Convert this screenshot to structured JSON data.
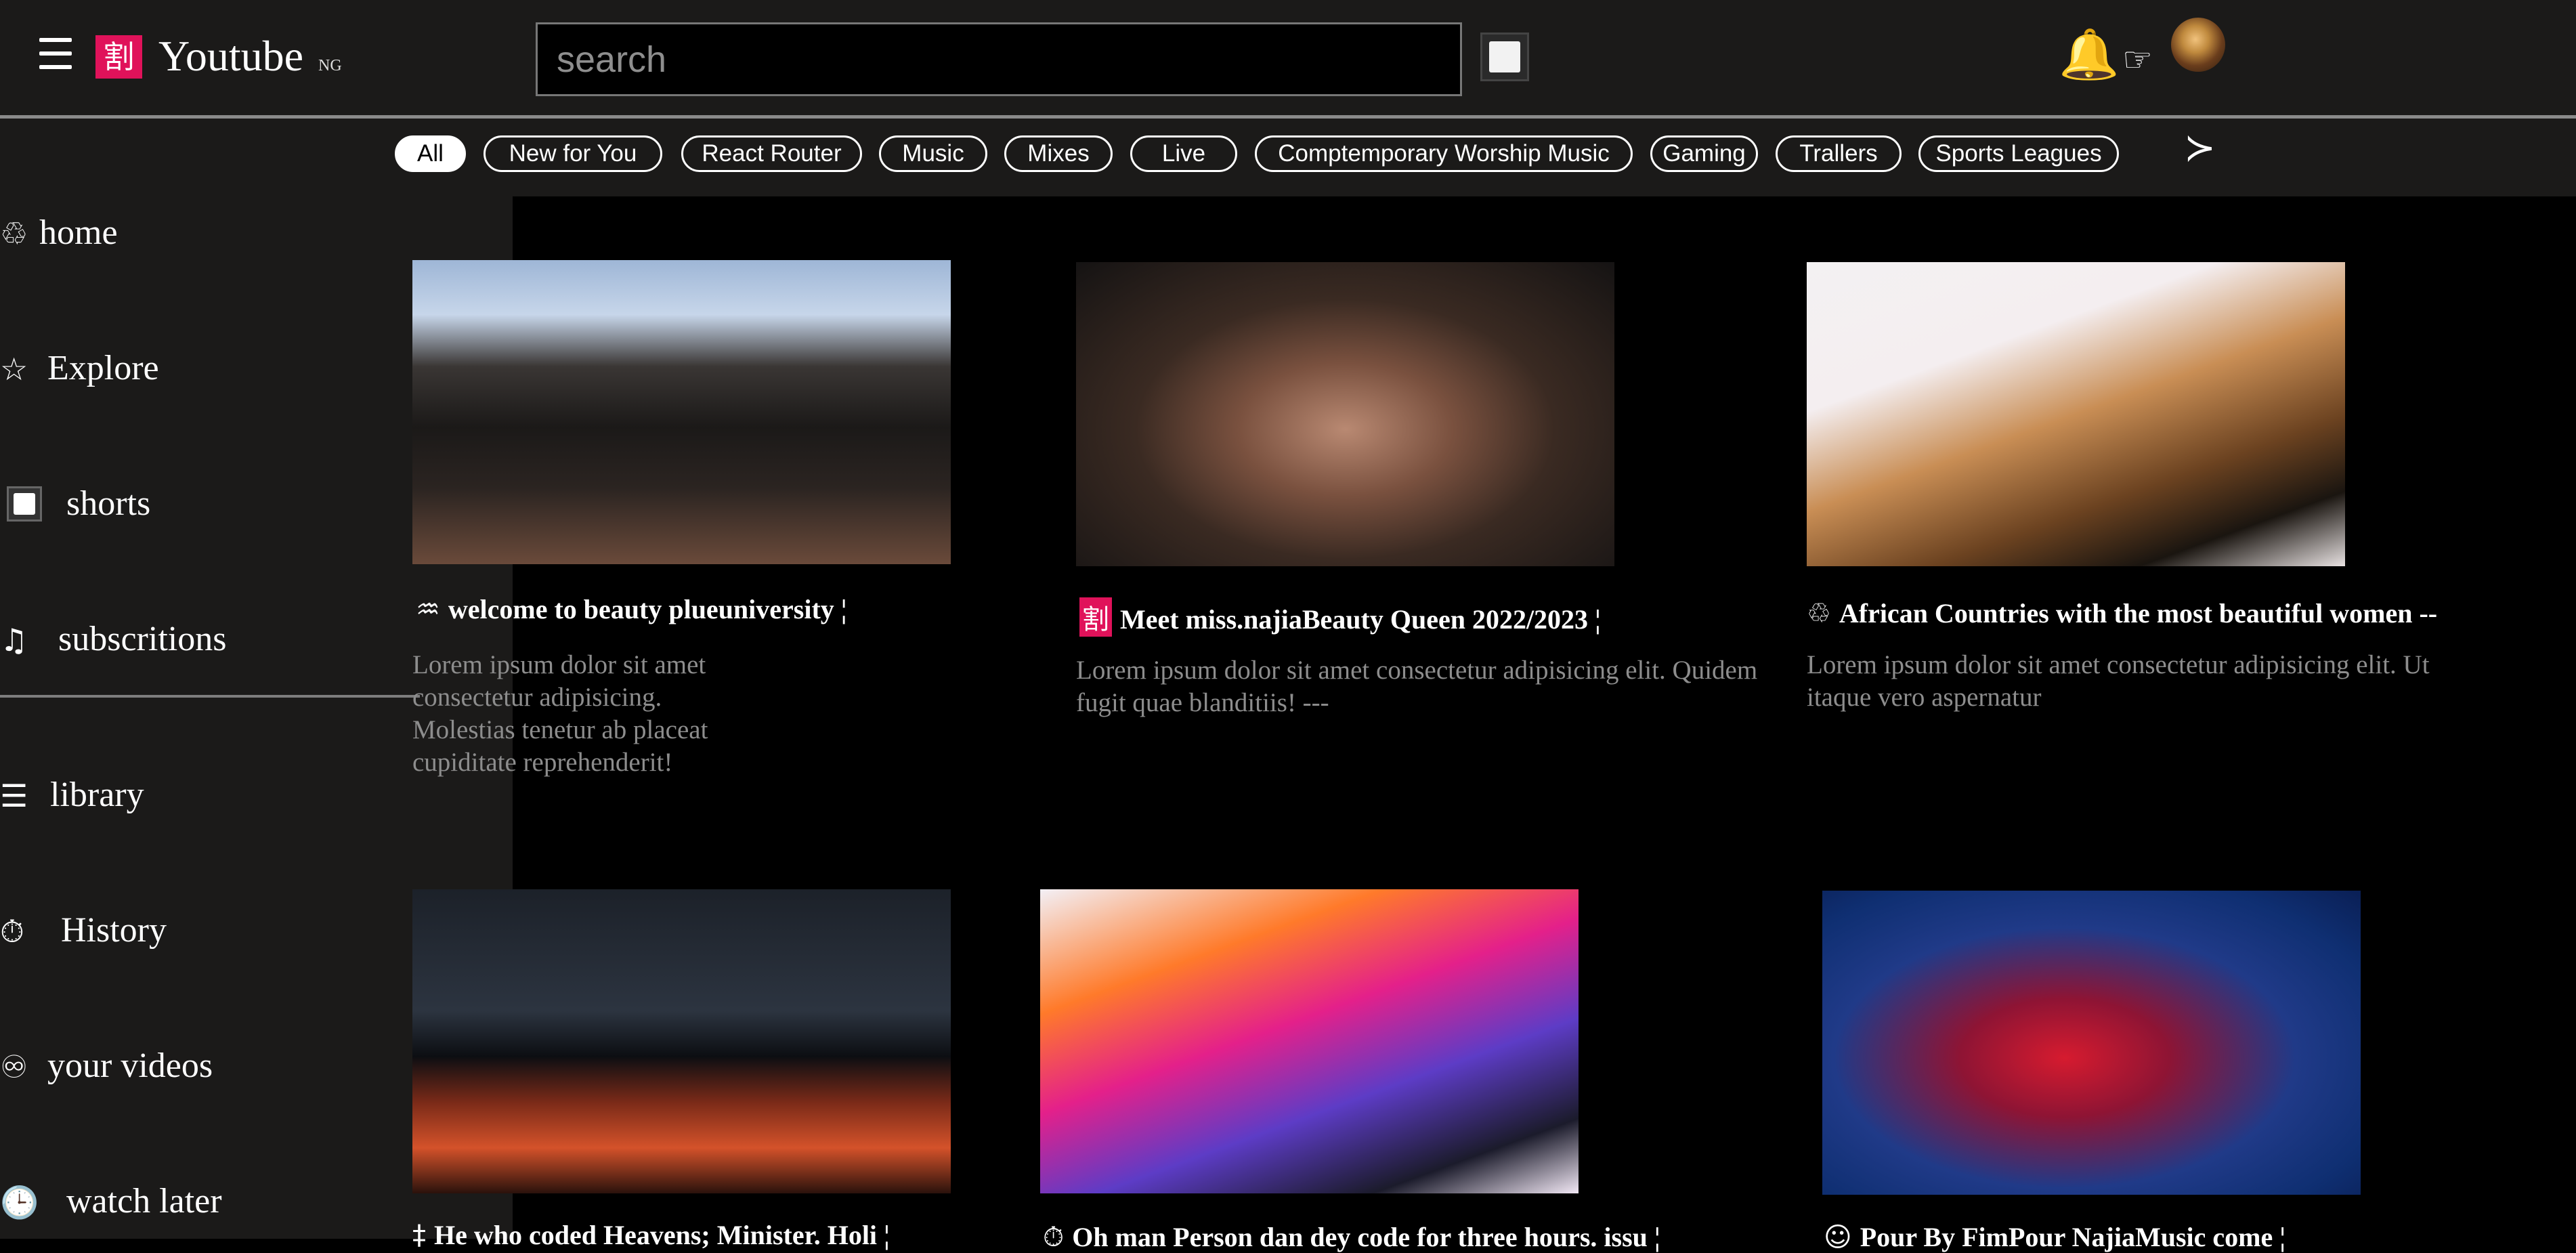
{
  "header": {
    "logo_glyph": "割",
    "logo_text": "Youtube",
    "region": "NG",
    "search_placeholder": "search"
  },
  "chips": [
    "All",
    "New for You",
    "React Router",
    "Music",
    "Mixes",
    "Live",
    "Comptemporary Worship Music",
    "Gaming",
    "Trallers",
    "Sports Leagues"
  ],
  "sidebar": {
    "items": [
      {
        "icon": "♲",
        "label": "home"
      },
      {
        "icon": "☆",
        "label": "Explore"
      },
      {
        "icon": "",
        "label": "shorts"
      },
      {
        "icon": "♫",
        "label": "subscritions"
      },
      {
        "icon": "☰",
        "label": "library"
      },
      {
        "icon": "⏱",
        "label": "History"
      },
      {
        "icon": "♾",
        "label": "your videos"
      },
      {
        "icon": "🕒",
        "label": "watch later"
      }
    ]
  },
  "videos": [
    {
      "icon": "♒",
      "title": "welcome to beauty plueuniversity ¦",
      "desc": "Lorem ipsum dolor sit amet consectetur adipisicing. Molestias tenetur ab placeat cupiditate reprehenderit!"
    },
    {
      "icon": "割",
      "title": "Meet miss.najiaBeauty Queen 2022/2023 ¦",
      "desc": "Lorem ipsum dolor sit amet consectetur adipisicing elit. Quidem fugit quae blanditiis! ---"
    },
    {
      "icon": "♲",
      "title": "African Countries with the most beautiful women --",
      "desc": "Lorem ipsum dolor sit amet consectetur adipisicing elit. Ut itaque vero aspernatur"
    },
    {
      "icon": "‡",
      "title": "He who coded Heavens; Minister. Holi ¦",
      "desc": ""
    },
    {
      "icon": "⏱",
      "title": "Oh man Person dan dey code for three hours. issu ¦",
      "desc": ""
    },
    {
      "icon": "☺",
      "title": "Pour By FimPour NajiaMusic come ¦",
      "desc": ""
    }
  ],
  "colors": {
    "logo_bg": "#e0125a",
    "topbar_bg": "#1b1a19",
    "sidebar_bg": "#1b1a19",
    "content_bg": "#000000",
    "desc_text": "#8d8d8d"
  }
}
